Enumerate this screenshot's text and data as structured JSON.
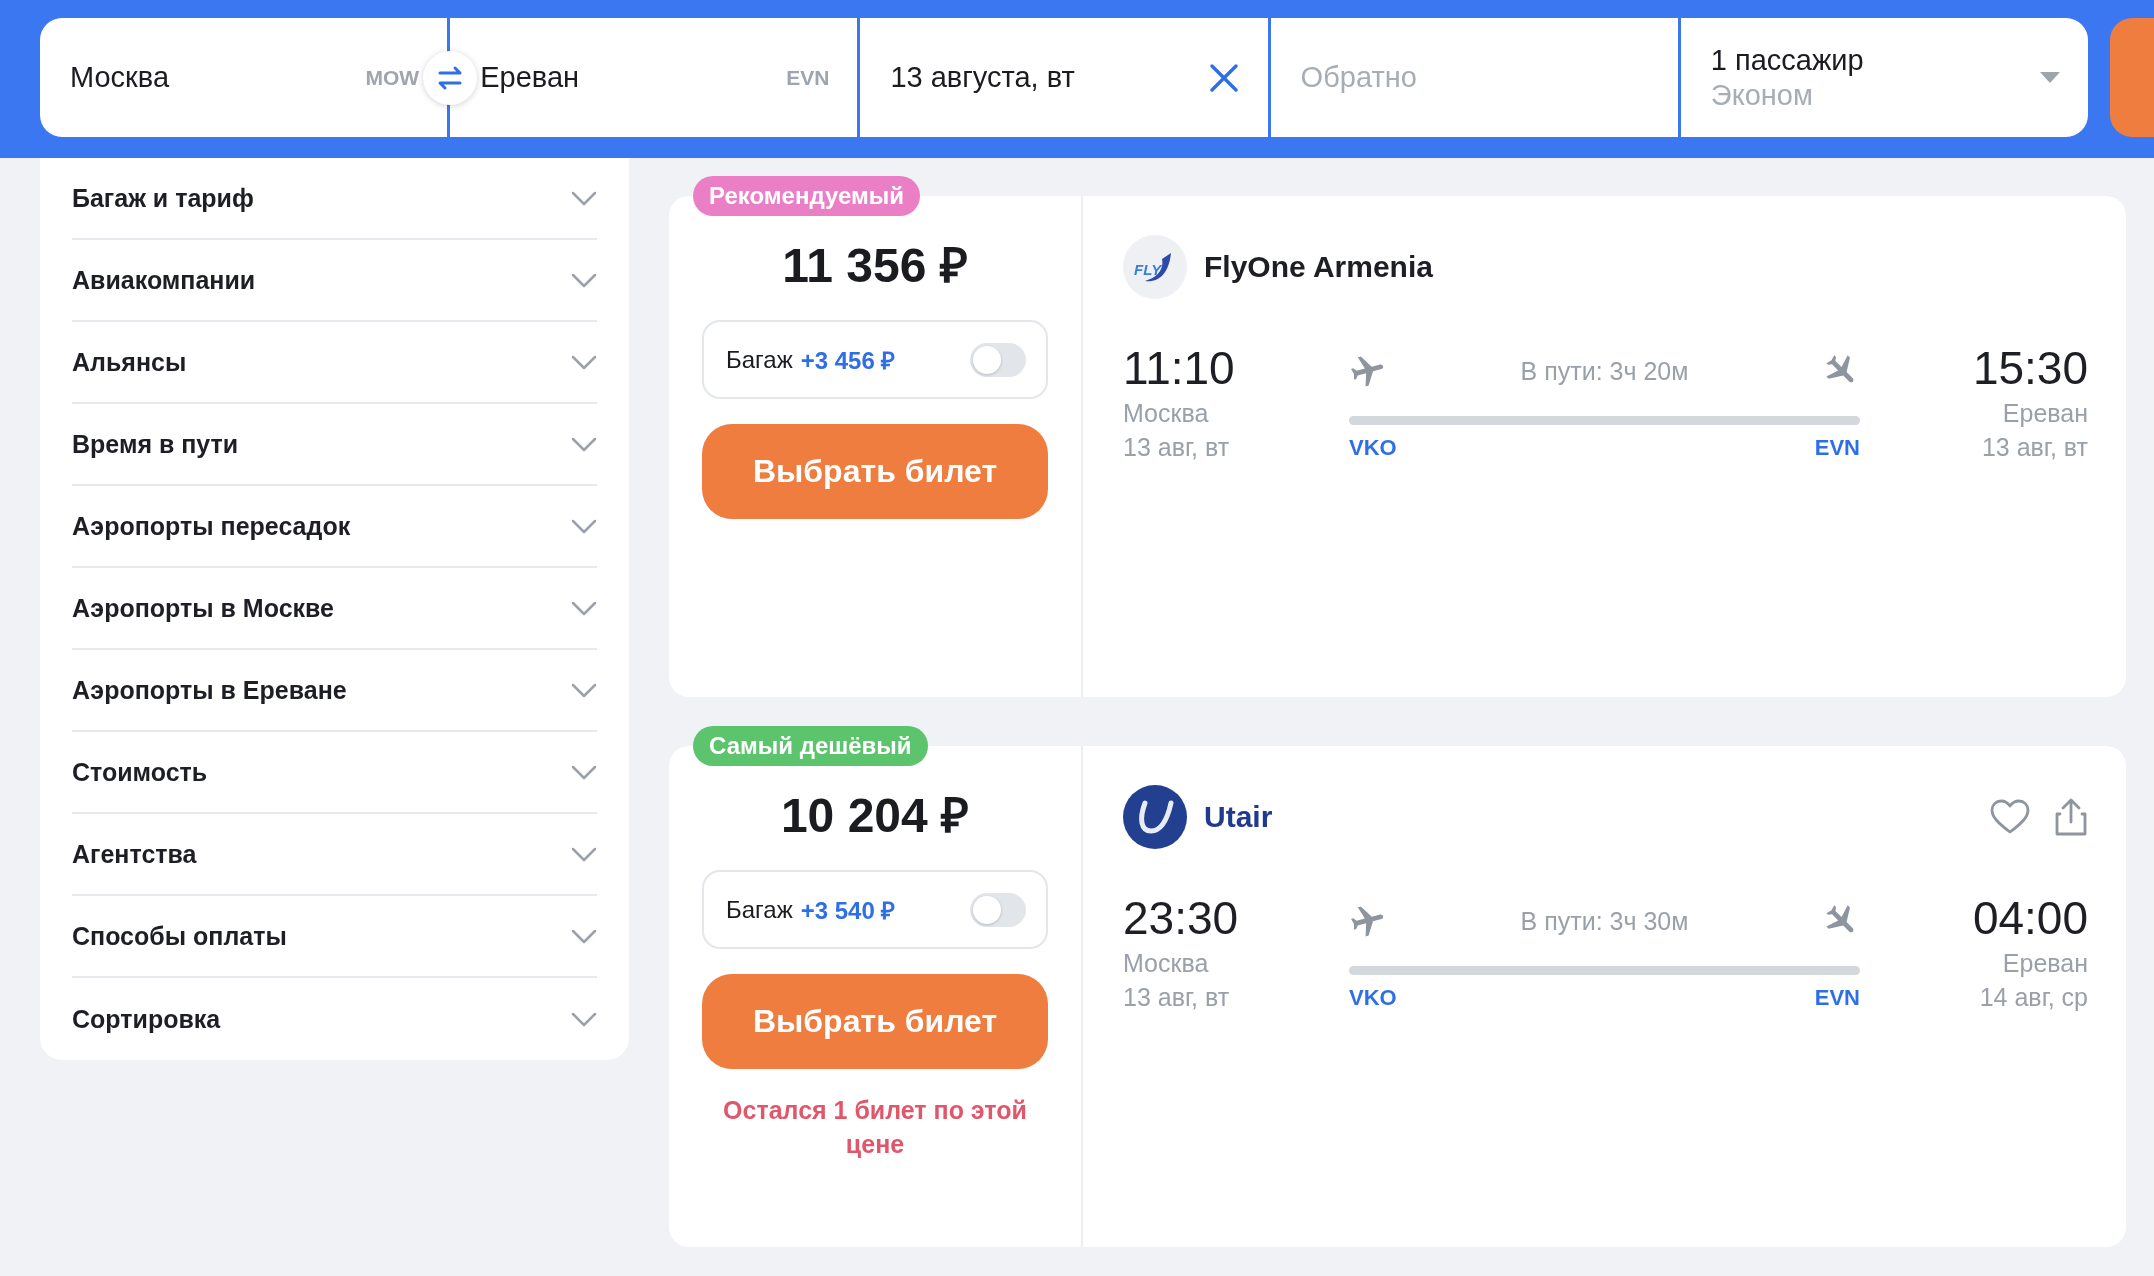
{
  "search": {
    "origin": {
      "city": "Москва",
      "code": "MOW"
    },
    "destination": {
      "city": "Ереван",
      "code": "EVN"
    },
    "date": {
      "value": "13 августа, вт"
    },
    "return_date": {
      "placeholder": "Обратно"
    },
    "passengers": {
      "count": "1 пассажир",
      "cabin": "Эконом"
    }
  },
  "filters": [
    {
      "label": "Багаж и тариф",
      "expanded": false
    },
    {
      "label": "Авиакомпании",
      "expanded": false
    },
    {
      "label": "Альянсы",
      "expanded": false
    },
    {
      "label": "Время в пути",
      "expanded": false
    },
    {
      "label": "Аэропорты пересадок",
      "expanded": false
    },
    {
      "label": "Аэропорты в Москве",
      "expanded": false
    },
    {
      "label": "Аэропорты в Ереване",
      "expanded": false
    },
    {
      "label": "Стоимость",
      "expanded": false
    },
    {
      "label": "Агентства",
      "expanded": false
    },
    {
      "label": "Способы оплаты",
      "expanded": false
    },
    {
      "label": "Сортировка",
      "expanded": false
    }
  ],
  "tickets": [
    {
      "badge": {
        "text": "Рекомендуемый",
        "color": "#ea7fc6"
      },
      "price": "11 356 ₽",
      "baggage": {
        "label": "Багаж",
        "price": "+3 456 ₽",
        "on": false
      },
      "button": "Выбрать билет",
      "airline": {
        "name": "FlyOne Armenia",
        "kind": "fly",
        "logo_text": "FLY"
      },
      "actions": false,
      "departure": {
        "time": "11:10",
        "city": "Москва",
        "date": "13 авг, вт",
        "airport": "VKO"
      },
      "duration": "В пути: 3ч 20м",
      "arrival": {
        "time": "15:30",
        "city": "Ереван",
        "date": "13 авг, вт",
        "airport": "EVN"
      }
    },
    {
      "badge": {
        "text": "Самый дешёвый",
        "color": "#5cc46c"
      },
      "price": "10 204 ₽",
      "baggage": {
        "label": "Багаж",
        "price": "+3 540 ₽",
        "on": false
      },
      "button": "Выбрать билет",
      "note": "Остался 1 билет по этой цене",
      "airline": {
        "name": "Utair",
        "kind": "swoosh"
      },
      "actions": true,
      "departure": {
        "time": "23:30",
        "city": "Москва",
        "date": "13 авг, вт",
        "airport": "VKO"
      },
      "duration": "В пути: 3ч 30м",
      "arrival": {
        "time": "04:00",
        "city": "Ереван",
        "date": "14 авг, ср",
        "airport": "EVN"
      }
    }
  ]
}
